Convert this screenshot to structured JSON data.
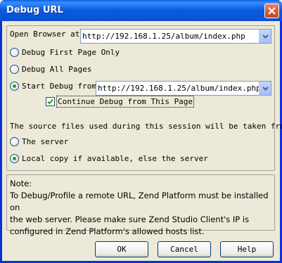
{
  "window": {
    "title": "Debug URL"
  },
  "open_browser": {
    "label": "Open Browser at:",
    "url": "http://192.168.1.25/album/index.php"
  },
  "options": {
    "first_page_only": "Debug First Page Only",
    "all_pages": "Debug All Pages",
    "start_debug_from": "Start Debug from:",
    "start_url": "http://192.168.1.25/album/index.php",
    "continue_debug": "Continue Debug from This Page",
    "selected": "start_debug_from",
    "continue_checked": true
  },
  "source": {
    "caption": "The source files used during this session will be taken from:",
    "server": "The server",
    "local_copy": "Local copy if available, else the server",
    "selected": "local_copy"
  },
  "note": {
    "heading": "Note:",
    "line1": "To Debug/Profile a remote URL, Zend Platform must be installed on",
    "line2": "the web server. Please make sure Zend Studio Client's IP is",
    "line3": "configured in Zend Platform's allowed hosts list."
  },
  "buttons": {
    "ok": "OK",
    "cancel": "Cancel",
    "help": "Help"
  }
}
